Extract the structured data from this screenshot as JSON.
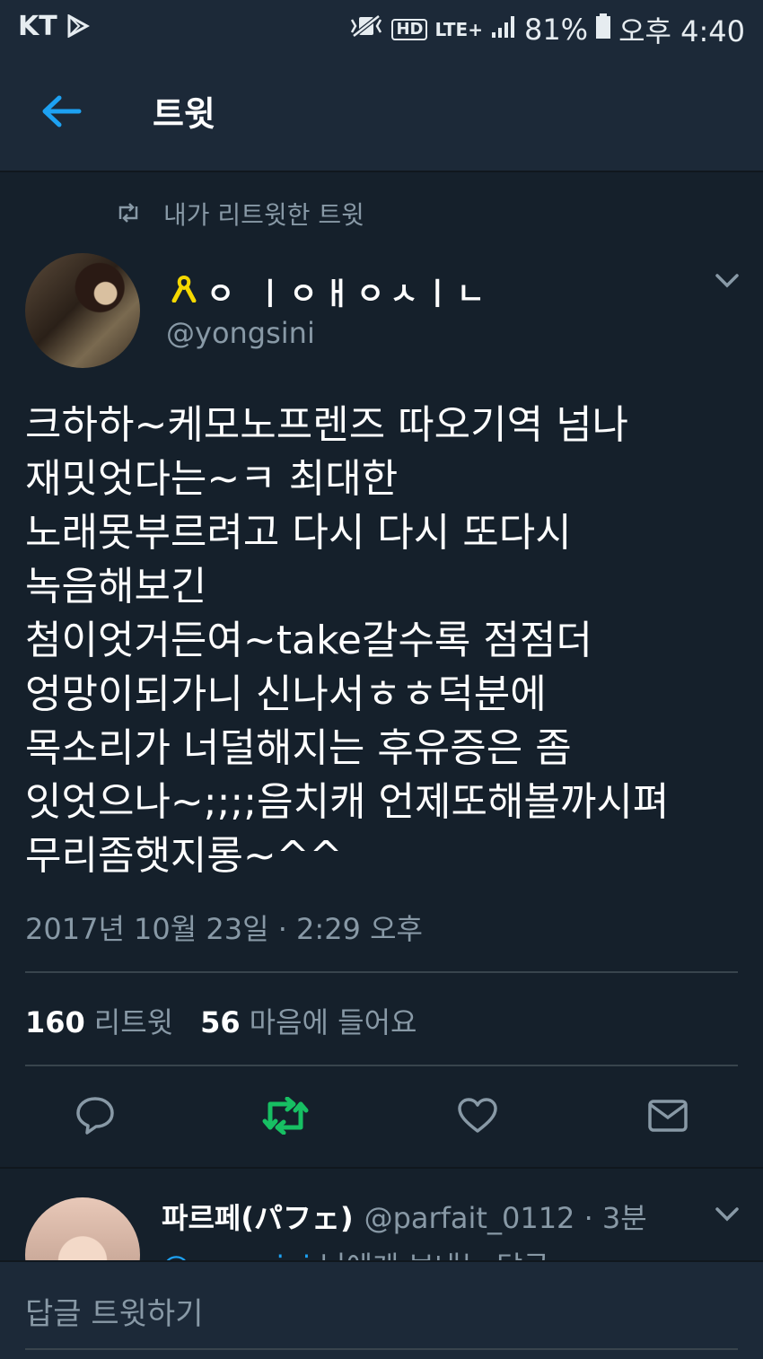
{
  "status_bar": {
    "carrier": "KT",
    "hd_label": "HD",
    "lte_label": "LTE+",
    "battery": "81%",
    "time": "오후 4:40"
  },
  "app_bar": {
    "title": "트윗"
  },
  "tweet": {
    "retweet_note": "내가 리트윗한 트윗",
    "display_name": "ㅇ ㅣㅇㅐㅇㅅㅣㄴ",
    "handle": "@yongsini",
    "text": "크하하~케모노프렌즈 따오기역 넘나\n재밋엇다는~ㅋ 최대한\n노래못부르려고 다시 다시 또다시\n녹음해보긴\n첨이엇거든여~take갈수록 점점더\n엉망이되가니 신나서ㅎㅎ덕분에\n목소리가 너덜해지는 후유증은 좀\n잇엇으나~;;;;음치캐 언제또해볼까시펴\n무리좀햇지롱~^^",
    "timestamp": "2017년 10월 23일 · 2:29 오후",
    "retweet_count": "160",
    "retweet_label": "리트윗",
    "like_count": "56",
    "like_label": "마음에 들어요"
  },
  "reply": {
    "name": "파르페(パフェ)",
    "handle_time": "@parfait_0112 · 3분",
    "mention": "@yongsini",
    "mention_suffix": " 님에게 보내는 답글"
  },
  "compose": {
    "placeholder": "답글 트윗하기"
  },
  "colors": {
    "background": "#15202b",
    "accent": "#1da1f2",
    "retweet_green": "#17bf63",
    "muted": "#8899a6"
  }
}
